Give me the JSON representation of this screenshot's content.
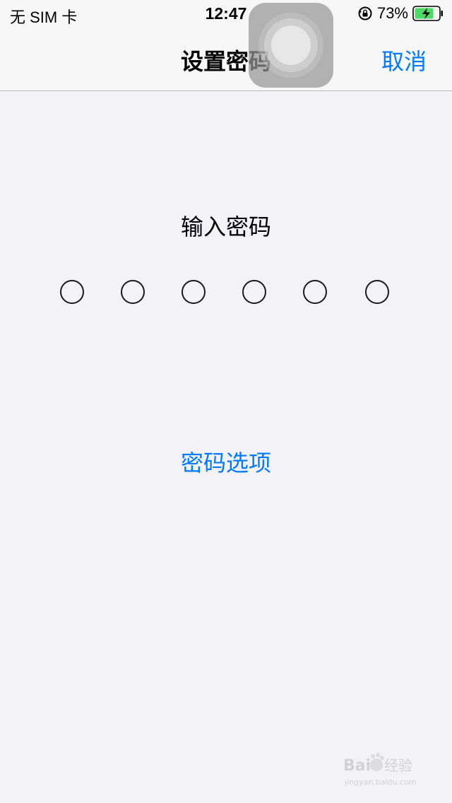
{
  "status_bar": {
    "carrier": "无 SIM 卡",
    "time": "12:47",
    "battery_percent": "73%",
    "icons": [
      "rotation-lock-icon",
      "battery-charging-icon"
    ]
  },
  "nav": {
    "title": "设置密码",
    "cancel_label": "取消"
  },
  "passcode": {
    "prompt": "输入密码",
    "digit_count": 6,
    "options_label": "密码选项"
  },
  "watermark": {
    "brand": "Baidu经验",
    "sub": "jingyan.baidu.com"
  },
  "colors": {
    "accent": "#007aff",
    "background": "#f2f2f7",
    "bar": "#f7f7f7",
    "battery_green": "#4cd964"
  }
}
